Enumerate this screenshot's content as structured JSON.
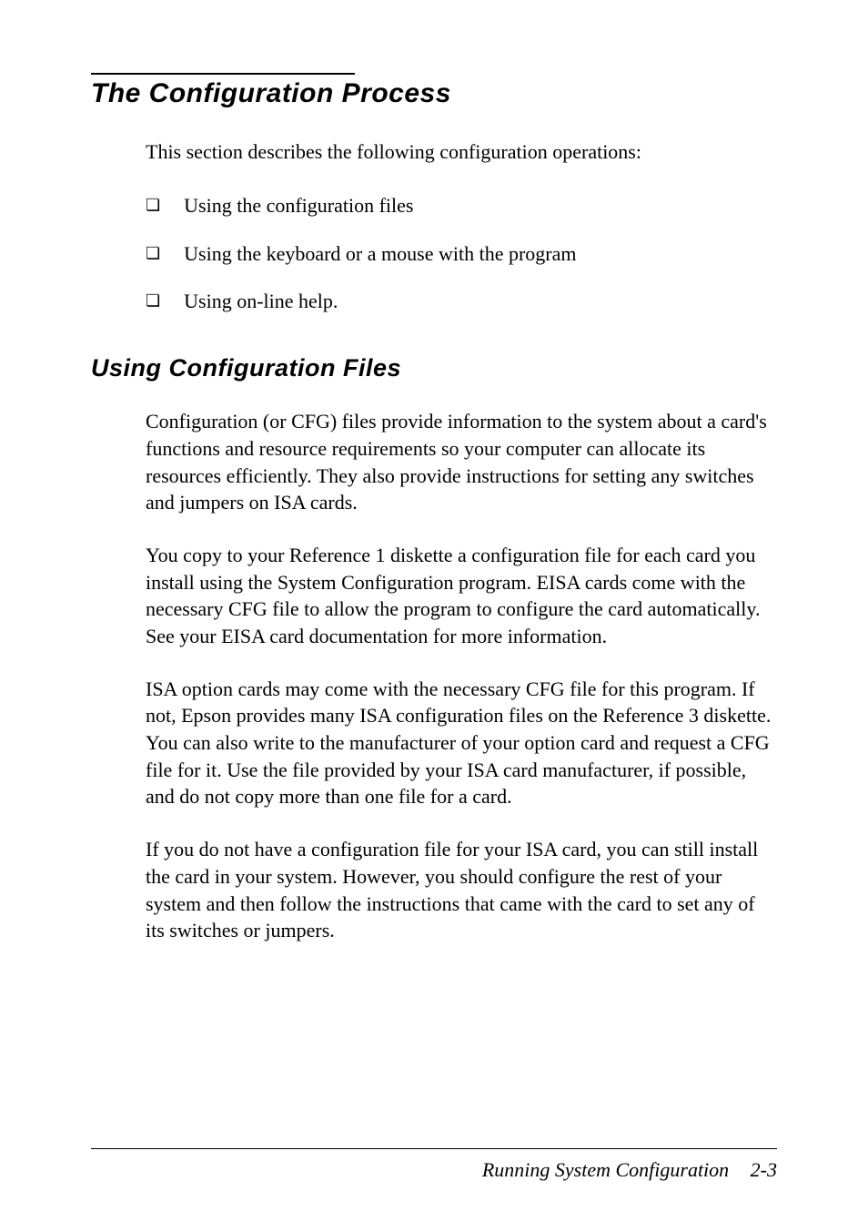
{
  "heading": "The Configuration Process",
  "intro": "This section describes the following configuration operations:",
  "bullets": [
    "Using the configuration files",
    "Using the keyboard or a mouse with the program",
    "Using on-line help."
  ],
  "subheading": "Using Configuration Files",
  "paragraphs": [
    "Configuration (or CFG) files provide information to the system about a card's functions and resource requirements so your computer can allocate its resources efficiently. They also provide instructions for setting any switches and jumpers on ISA cards.",
    "You copy to your Reference 1 diskette a configuration file for each card you install using the System Configuration program. EISA cards come with the necessary CFG file to allow the program to configure the card automatically. See your EISA card documentation for more information.",
    "ISA option cards may come with the necessary CFG file for this program. If not, Epson provides many ISA configuration files on the Reference 3 diskette. You can also write to the manufacturer of your option card and request a CFG file for it. Use the file provided by your ISA card manufacturer, if possible, and do not copy more than one file for a card.",
    "If you do not have a configuration file for your ISA card, you can still install the card in your system. However, you should configure the rest of your system and then follow the instructions that came with the card to set any of its switches or jumpers."
  ],
  "footer": {
    "title": "Running System Configuration",
    "page": "2-3"
  }
}
